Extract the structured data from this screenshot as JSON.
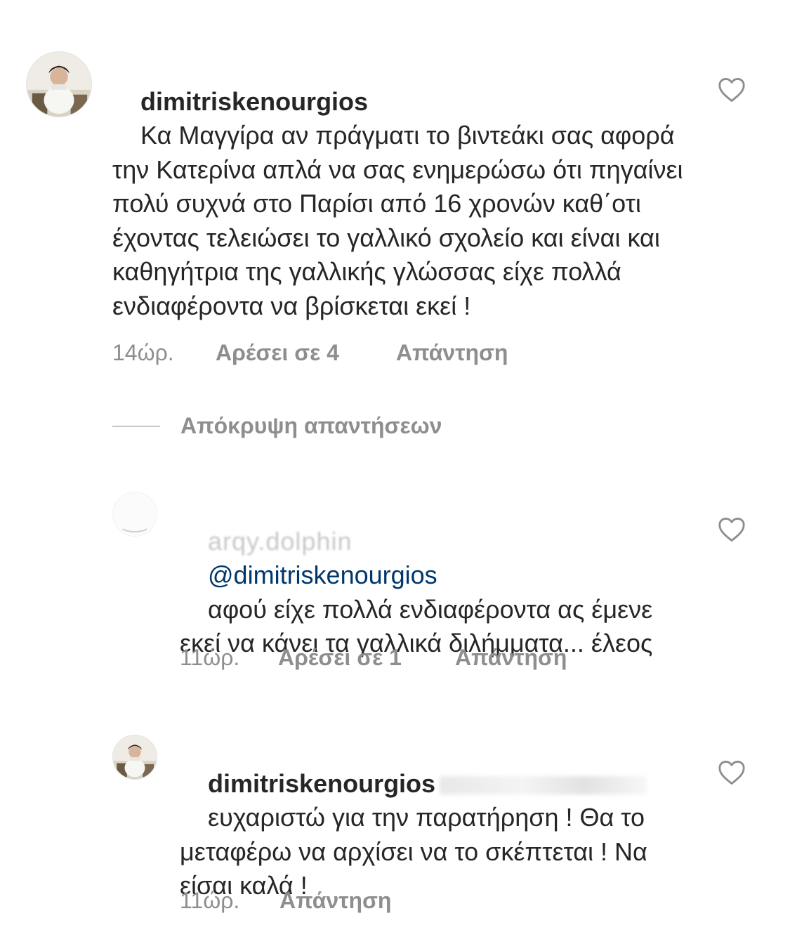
{
  "comments": [
    {
      "username": "dimitriskenourgios",
      "text": "Κα Μαγγίρα αν πράγματι το βιντεάκι σας αφορά την Κατερίνα απλά να σας ενημερώσω ότι πηγαίνει πολύ συχνά στο Παρίσι από 16 χρονών καθ΄οτι έχοντας τελειώσει το γαλλικό σχολείο και είναι και καθηγήτρια της γαλλικής γλώσσας είχε πολλά ενδιαφέροντα να βρίσκεται εκεί !",
      "time": "14ώρ.",
      "likes": "Αρέσει σε 4",
      "reply": "Απάντηση",
      "like_icon": "heart-outline-icon"
    }
  ],
  "replies_toggle": {
    "label": "Απόκρυψη απαντήσεων"
  },
  "replies": [
    {
      "username": "arqy.dolphin",
      "mention": "@dimitriskenourgios",
      "text": "αφού είχε πολλά ενδιαφέροντα ας έμενε εκεί να κάνει τα γαλλικά διλήμματα... έλεος",
      "time": "11ώρ.",
      "likes": "Αρέσει σε 1",
      "reply": "Απάντηση",
      "like_icon": "heart-outline-icon"
    },
    {
      "username": "dimitriskenourgios",
      "text": "ευχαριστώ για την παρατήρηση ! Θα το μεταφέρω να αρχίσει να το σκέπτεται ! Να είσαι καλά !",
      "time": "11ώρ.",
      "reply": "Απάντηση",
      "like_icon": "heart-outline-icon"
    }
  ],
  "colors": {
    "text": "#262626",
    "muted": "#8e8e8e",
    "mention": "#00376b",
    "divider": "#c7c7c7"
  }
}
